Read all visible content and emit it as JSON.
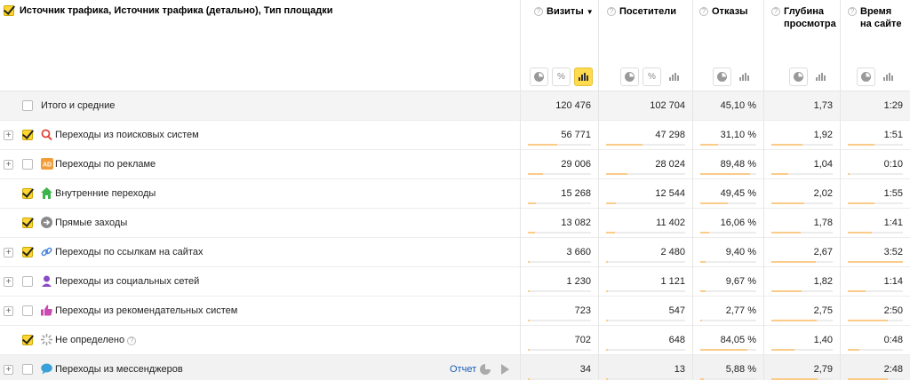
{
  "header": {
    "dimension_title": "Источник трафика, Источник трафика (детально), Тип площадки",
    "columns": [
      {
        "title": "Визиты",
        "sort": "▼"
      },
      {
        "title": "Посетители"
      },
      {
        "title": "Отказы"
      },
      {
        "title": "Глубина просмотра",
        "title_line1": "Глубина",
        "title_line2": "просмотра"
      },
      {
        "title": "Время на сайте",
        "title_line1": "Время",
        "title_line2": "на сайте"
      }
    ],
    "help_glyph": "?",
    "percent_glyph": "%",
    "expand_glyph": "+"
  },
  "total": {
    "label": "Итого и средние",
    "visits": "120 476",
    "visitors": "102 704",
    "bounce": "45,10 %",
    "depth": "1,73",
    "time": "1:29"
  },
  "rows": [
    {
      "label": "Переходы из поисковых систем",
      "icon": "search-icon",
      "checked": true,
      "expandable": true,
      "visits": "56 771",
      "visitors": "47 298",
      "bounce": "31,10 %",
      "depth": "1,92",
      "time": "1:51",
      "fill": {
        "visits": 0.471,
        "visitors": 0.46,
        "bounce": 0.311,
        "depth": 0.51,
        "time": 0.48
      }
    },
    {
      "label": "Переходы по рекламе",
      "icon": "ad-icon",
      "checked": false,
      "expandable": true,
      "visits": "29 006",
      "visitors": "28 024",
      "bounce": "89,48 %",
      "depth": "1,04",
      "time": "0:10",
      "fill": {
        "visits": 0.241,
        "visitors": 0.273,
        "bounce": 0.895,
        "depth": 0.28,
        "time": 0.04
      }
    },
    {
      "label": "Внутренние переходы",
      "icon": "home-icon",
      "checked": true,
      "expandable": false,
      "visits": "15 268",
      "visitors": "12 544",
      "bounce": "49,45 %",
      "depth": "2,02",
      "time": "1:55",
      "fill": {
        "visits": 0.127,
        "visitors": 0.122,
        "bounce": 0.495,
        "depth": 0.54,
        "time": 0.49
      }
    },
    {
      "label": "Прямые заходы",
      "icon": "direct-arrow-icon",
      "checked": true,
      "expandable": false,
      "visits": "13 082",
      "visitors": "11 402",
      "bounce": "16,06 %",
      "depth": "1,78",
      "time": "1:41",
      "fill": {
        "visits": 0.109,
        "visitors": 0.111,
        "bounce": 0.161,
        "depth": 0.48,
        "time": 0.43
      }
    },
    {
      "label": "Переходы по ссылкам на сайтах",
      "icon": "link-icon",
      "checked": true,
      "expandable": true,
      "visits": "3 660",
      "visitors": "2 480",
      "bounce": "9,40 %",
      "depth": "2,67",
      "time": "3:52",
      "fill": {
        "visits": 0.03,
        "visitors": 0.024,
        "bounce": 0.094,
        "depth": 0.72,
        "time": 1.0
      }
    },
    {
      "label": "Переходы из социальных сетей",
      "icon": "social-icon",
      "checked": false,
      "expandable": true,
      "visits": "1 230",
      "visitors": "1 121",
      "bounce": "9,67 %",
      "depth": "1,82",
      "time": "1:14",
      "fill": {
        "visits": 0.01,
        "visitors": 0.011,
        "bounce": 0.097,
        "depth": 0.49,
        "time": 0.32
      }
    },
    {
      "label": "Переходы из рекомендательных систем",
      "icon": "thumbs-up-icon",
      "checked": false,
      "expandable": true,
      "visits": "723",
      "visitors": "547",
      "bounce": "2,77 %",
      "depth": "2,75",
      "time": "2:50",
      "fill": {
        "visits": 0.006,
        "visitors": 0.005,
        "bounce": 0.028,
        "depth": 0.74,
        "time": 0.73
      }
    },
    {
      "label": "Не определено",
      "icon": "undefined-icon",
      "checked": true,
      "expandable": false,
      "has_help": true,
      "visits": "702",
      "visitors": "648",
      "bounce": "84,05 %",
      "depth": "1,40",
      "time": "0:48",
      "fill": {
        "visits": 0.006,
        "visitors": 0.006,
        "bounce": 0.84,
        "depth": 0.38,
        "time": 0.21
      }
    },
    {
      "label": "Переходы из мессенджеров",
      "icon": "messenger-icon",
      "checked": false,
      "expandable": true,
      "hover": true,
      "visits": "34",
      "visitors": "13",
      "bounce": "5,88 %",
      "depth": "2,79",
      "time": "2:48",
      "fill": {
        "visits": 0.0003,
        "visitors": 0.0001,
        "bounce": 0.059,
        "depth": 0.75,
        "time": 0.72
      }
    }
  ],
  "hover_actions": {
    "report_link": "Отчет"
  },
  "colors": {
    "accent_yellow": "#ffdb4d",
    "bar_fill": "#fbcb8a",
    "link": "#1a5db5",
    "search_icon": "#e0443a",
    "ad_icon": "#f29d38",
    "home_icon": "#3cb64a",
    "direct_icon": "#8a8a8a",
    "link_icon": "#4a84d8",
    "social_icon": "#8a4ac7",
    "thumbs_icon": "#c94ab0",
    "messenger_icon": "#3aa0d8"
  }
}
